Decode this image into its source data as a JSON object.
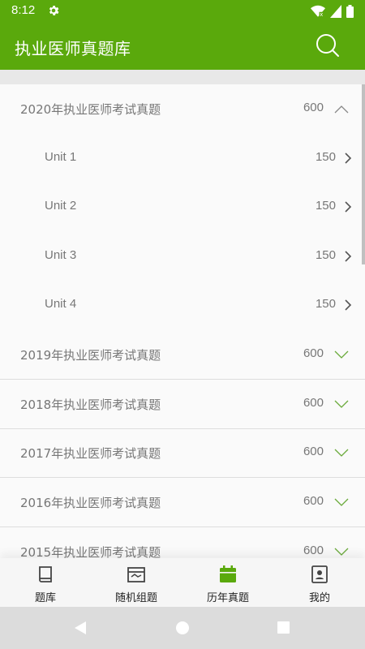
{
  "status": {
    "time": "8:12"
  },
  "app": {
    "title": "执业医师真题库"
  },
  "groups": [
    {
      "label": "2020年执业医师考试真题",
      "count": "600",
      "expanded": true,
      "units": [
        {
          "label": "Unit 1",
          "count": "150"
        },
        {
          "label": "Unit 2",
          "count": "150"
        },
        {
          "label": "Unit 3",
          "count": "150"
        },
        {
          "label": "Unit 4",
          "count": "150"
        }
      ]
    },
    {
      "label": "2019年执业医师考试真题",
      "count": "600",
      "expanded": false
    },
    {
      "label": "2018年执业医师考试真题",
      "count": "600",
      "expanded": false
    },
    {
      "label": "2017年执业医师考试真题",
      "count": "600",
      "expanded": false
    },
    {
      "label": "2016年执业医师考试真题",
      "count": "600",
      "expanded": false
    },
    {
      "label": "2015年执业医师考试真题",
      "count": "600",
      "expanded": false
    }
  ],
  "nav": {
    "items": [
      {
        "label": "题库",
        "icon": "book-icon",
        "active": false
      },
      {
        "label": "随机组题",
        "icon": "card-icon",
        "active": false
      },
      {
        "label": "历年真题",
        "icon": "calendar-icon",
        "active": true
      },
      {
        "label": "我的",
        "icon": "contact-icon",
        "active": false
      }
    ]
  },
  "colors": {
    "accent": "#5aa90c",
    "text": "#777777",
    "navText": "#222222"
  }
}
